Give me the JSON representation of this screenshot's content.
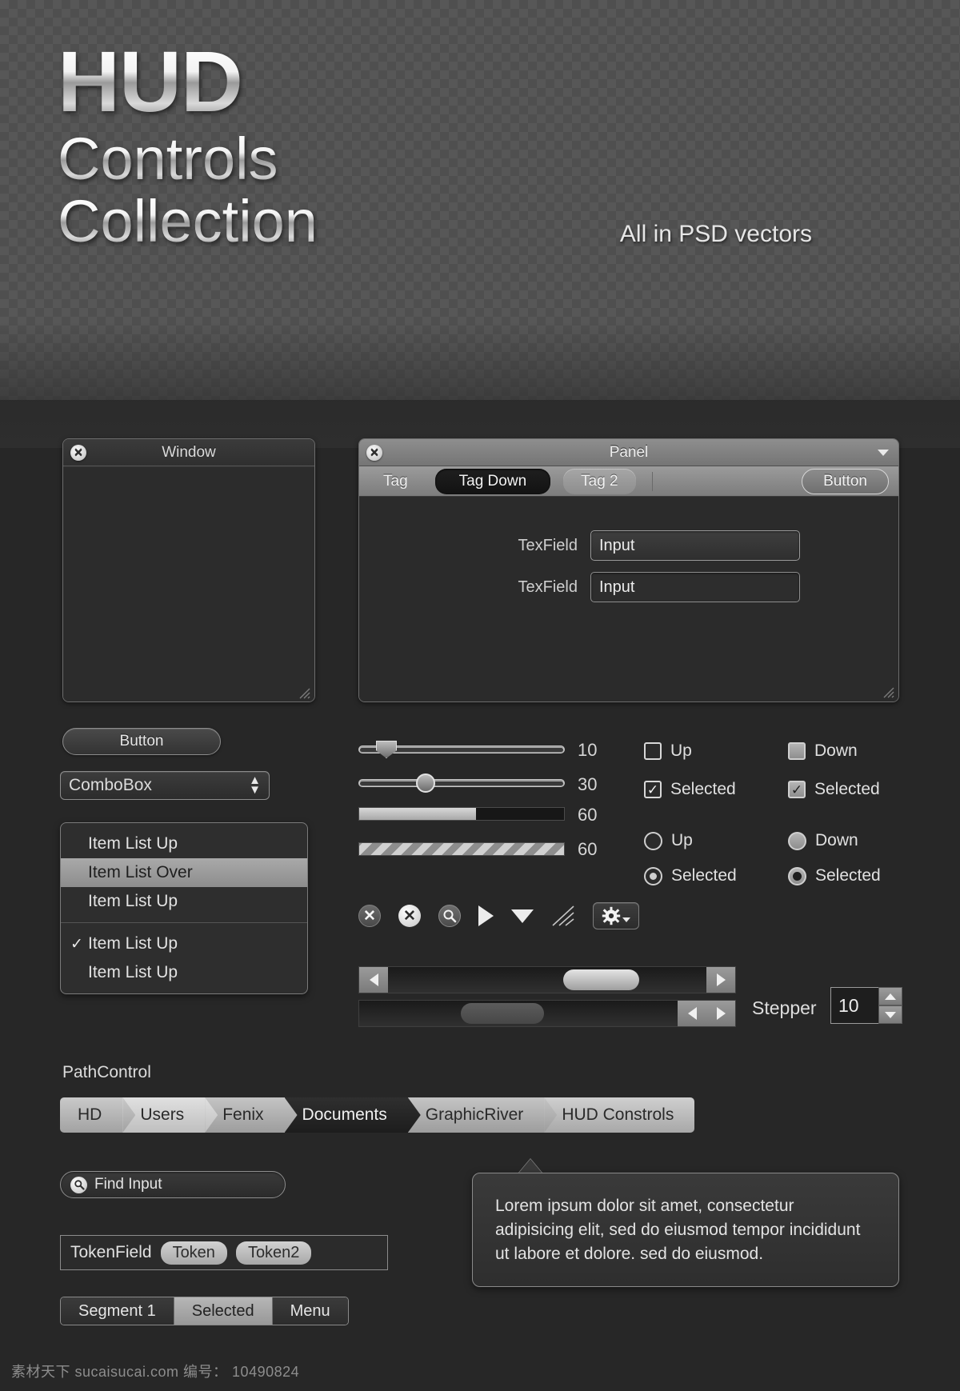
{
  "hero": {
    "line1": "HUD",
    "line2": "Controls",
    "line3": "Collection",
    "tagline": "All in PSD vectors"
  },
  "window": {
    "title": "Window",
    "close_icon": "close-icon"
  },
  "panel": {
    "title": "Panel",
    "close_icon": "close-icon",
    "disclosure_icon": "chevron-down-icon",
    "tabs": [
      {
        "label": "Tag",
        "state": "plain"
      },
      {
        "label": "Tag Down",
        "state": "down"
      },
      {
        "label": "Tag 2",
        "state": "alt"
      }
    ],
    "toolbar_button": "Button",
    "fields": [
      {
        "label": "TexField",
        "value": "Input"
      },
      {
        "label": "TexField",
        "value": "Input"
      }
    ]
  },
  "controls": {
    "button_label": "Button",
    "combobox_value": "ComboBox",
    "combobox_icon": "up-down-chevron-icon"
  },
  "item_list": {
    "items": [
      {
        "label": "Item List Up",
        "state": "normal",
        "checked": false
      },
      {
        "label": "Item List Over",
        "state": "over",
        "checked": false
      },
      {
        "label": "Item List Up",
        "state": "normal",
        "checked": false
      },
      {
        "label": "Item List Up",
        "state": "normal",
        "checked": true
      },
      {
        "label": "Item List Up",
        "state": "normal",
        "checked": false
      }
    ]
  },
  "sliders": [
    {
      "type": "slider-triangle",
      "value": "10",
      "percent": 12
    },
    {
      "type": "slider-round",
      "value": "30",
      "percent": 32
    },
    {
      "type": "progress-solid",
      "value": "60",
      "percent": 57
    },
    {
      "type": "progress-striped",
      "value": "60",
      "percent": 100
    }
  ],
  "checkboxes": [
    {
      "label": "Up",
      "style": "dark",
      "checked": false
    },
    {
      "label": "Down",
      "style": "light",
      "checked": false
    },
    {
      "label": "Selected",
      "style": "dark",
      "checked": true
    },
    {
      "label": "Selected",
      "style": "light",
      "checked": true
    }
  ],
  "radios": [
    {
      "label": "Up",
      "style": "dark",
      "selected": false
    },
    {
      "label": "Down",
      "style": "light",
      "selected": false
    },
    {
      "label": "Selected",
      "style": "dark",
      "selected": true
    },
    {
      "label": "Selected",
      "style": "light",
      "selected": true
    }
  ],
  "icons": [
    "close-circle-dark-icon",
    "close-circle-light-icon",
    "search-circle-icon",
    "play-triangle-icon",
    "dropdown-triangle-icon",
    "resize-grip-icon",
    "gear-menu-button"
  ],
  "scrollbars": [
    {
      "style": "split-arrows",
      "thumb_percent_left": 55,
      "thumb_percent_width": 24
    },
    {
      "style": "paired-arrows",
      "thumb_percent_left": 32,
      "thumb_percent_width": 26
    }
  ],
  "stepper": {
    "label": "Stepper",
    "value": "10",
    "up_icon": "stepper-up-icon",
    "down_icon": "stepper-down-icon"
  },
  "path_control": {
    "label": "PathControl",
    "crumbs": [
      {
        "label": "HD",
        "active": false
      },
      {
        "label": "Users",
        "active": false
      },
      {
        "label": "Fenix",
        "active": false
      },
      {
        "label": "Documents",
        "active": true
      },
      {
        "label": "GraphicRiver",
        "active": false
      },
      {
        "label": "HUD Constrols",
        "active": false
      }
    ]
  },
  "find": {
    "value": "Find Input",
    "icon": "search-icon"
  },
  "token_field": {
    "label": "TokenField",
    "tokens": [
      "Token",
      "Token2"
    ]
  },
  "segments": [
    {
      "label": "Segment 1",
      "selected": false
    },
    {
      "label": "Selected",
      "selected": true
    },
    {
      "label": "Menu",
      "selected": false
    }
  ],
  "tooltip": {
    "text": "Lorem ipsum dolor sit amet, consectetur adipisicing elit, sed do eiusmod tempor incididunt ut labore et dolore. sed do eiusmod."
  },
  "footer": {
    "text": "素材天下 sucaisucai.com  编号： 10490824"
  }
}
